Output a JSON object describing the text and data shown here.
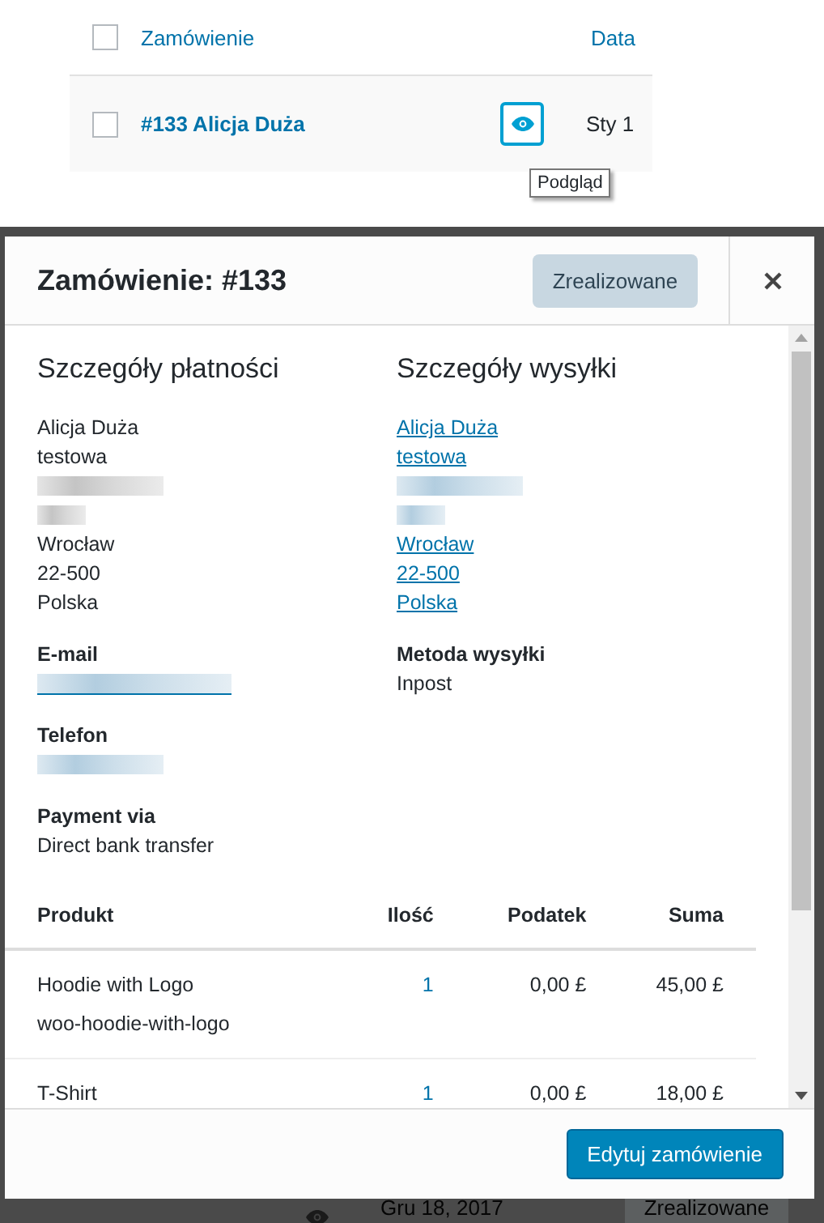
{
  "list": {
    "columns": [
      {
        "label": "Zamówienie"
      },
      {
        "label": "Data"
      }
    ],
    "header_checked": false,
    "rows": [
      {
        "checked": false,
        "title": "#133 Alicja Duża",
        "date": "Sty 1",
        "tooltip": "Podgląd"
      }
    ]
  },
  "modal": {
    "title": "Zamówienie: #133",
    "status": "Zrealizowane",
    "billing": {
      "heading": "Szczegóły płatności",
      "address": [
        {
          "kind": "text",
          "text": "Alicja Duża"
        },
        {
          "kind": "text",
          "text": "testowa"
        },
        {
          "kind": "blurlong"
        },
        {
          "kind": "blurshort"
        },
        {
          "kind": "text",
          "text": "Wrocław"
        },
        {
          "kind": "text",
          "text": "22-500"
        },
        {
          "kind": "text",
          "text": "Polska"
        }
      ],
      "fields": [
        {
          "label": "E-mail",
          "kind": "blurlink"
        },
        {
          "label": "Telefon",
          "kind": "blurlong"
        },
        {
          "label": "Payment via",
          "kind": "text",
          "value": "Direct bank transfer"
        }
      ]
    },
    "shipping": {
      "heading": "Szczegóły wysyłki",
      "address": [
        {
          "kind": "link",
          "text": "Alicja Duża"
        },
        {
          "kind": "link",
          "text": "testowa"
        },
        {
          "kind": "blurlong"
        },
        {
          "kind": "blurshort"
        },
        {
          "kind": "link",
          "text": "Wrocław"
        },
        {
          "kind": "link",
          "text": "22-500"
        },
        {
          "kind": "link",
          "text": "Polska"
        }
      ],
      "fields": [
        {
          "label": "Metoda wysyłki",
          "kind": "text",
          "value": "Inpost"
        }
      ]
    },
    "table": {
      "columns": [
        "Produkt",
        "Ilość",
        "Podatek",
        "Suma"
      ],
      "rows": [
        {
          "product": "Hoodie with Logo",
          "sku": "woo-hoodie-with-logo",
          "quantity": "1",
          "tax": "0,00 £",
          "total": "45,00 £"
        },
        {
          "product": "T-Shirt",
          "quantity": "1",
          "tax": "0,00 £",
          "total": "18,00 £"
        }
      ]
    },
    "footer_button": "Edytuj zamówienie"
  },
  "background_row": {
    "date": "Gru 18, 2017",
    "status": "Zrealizowane"
  }
}
